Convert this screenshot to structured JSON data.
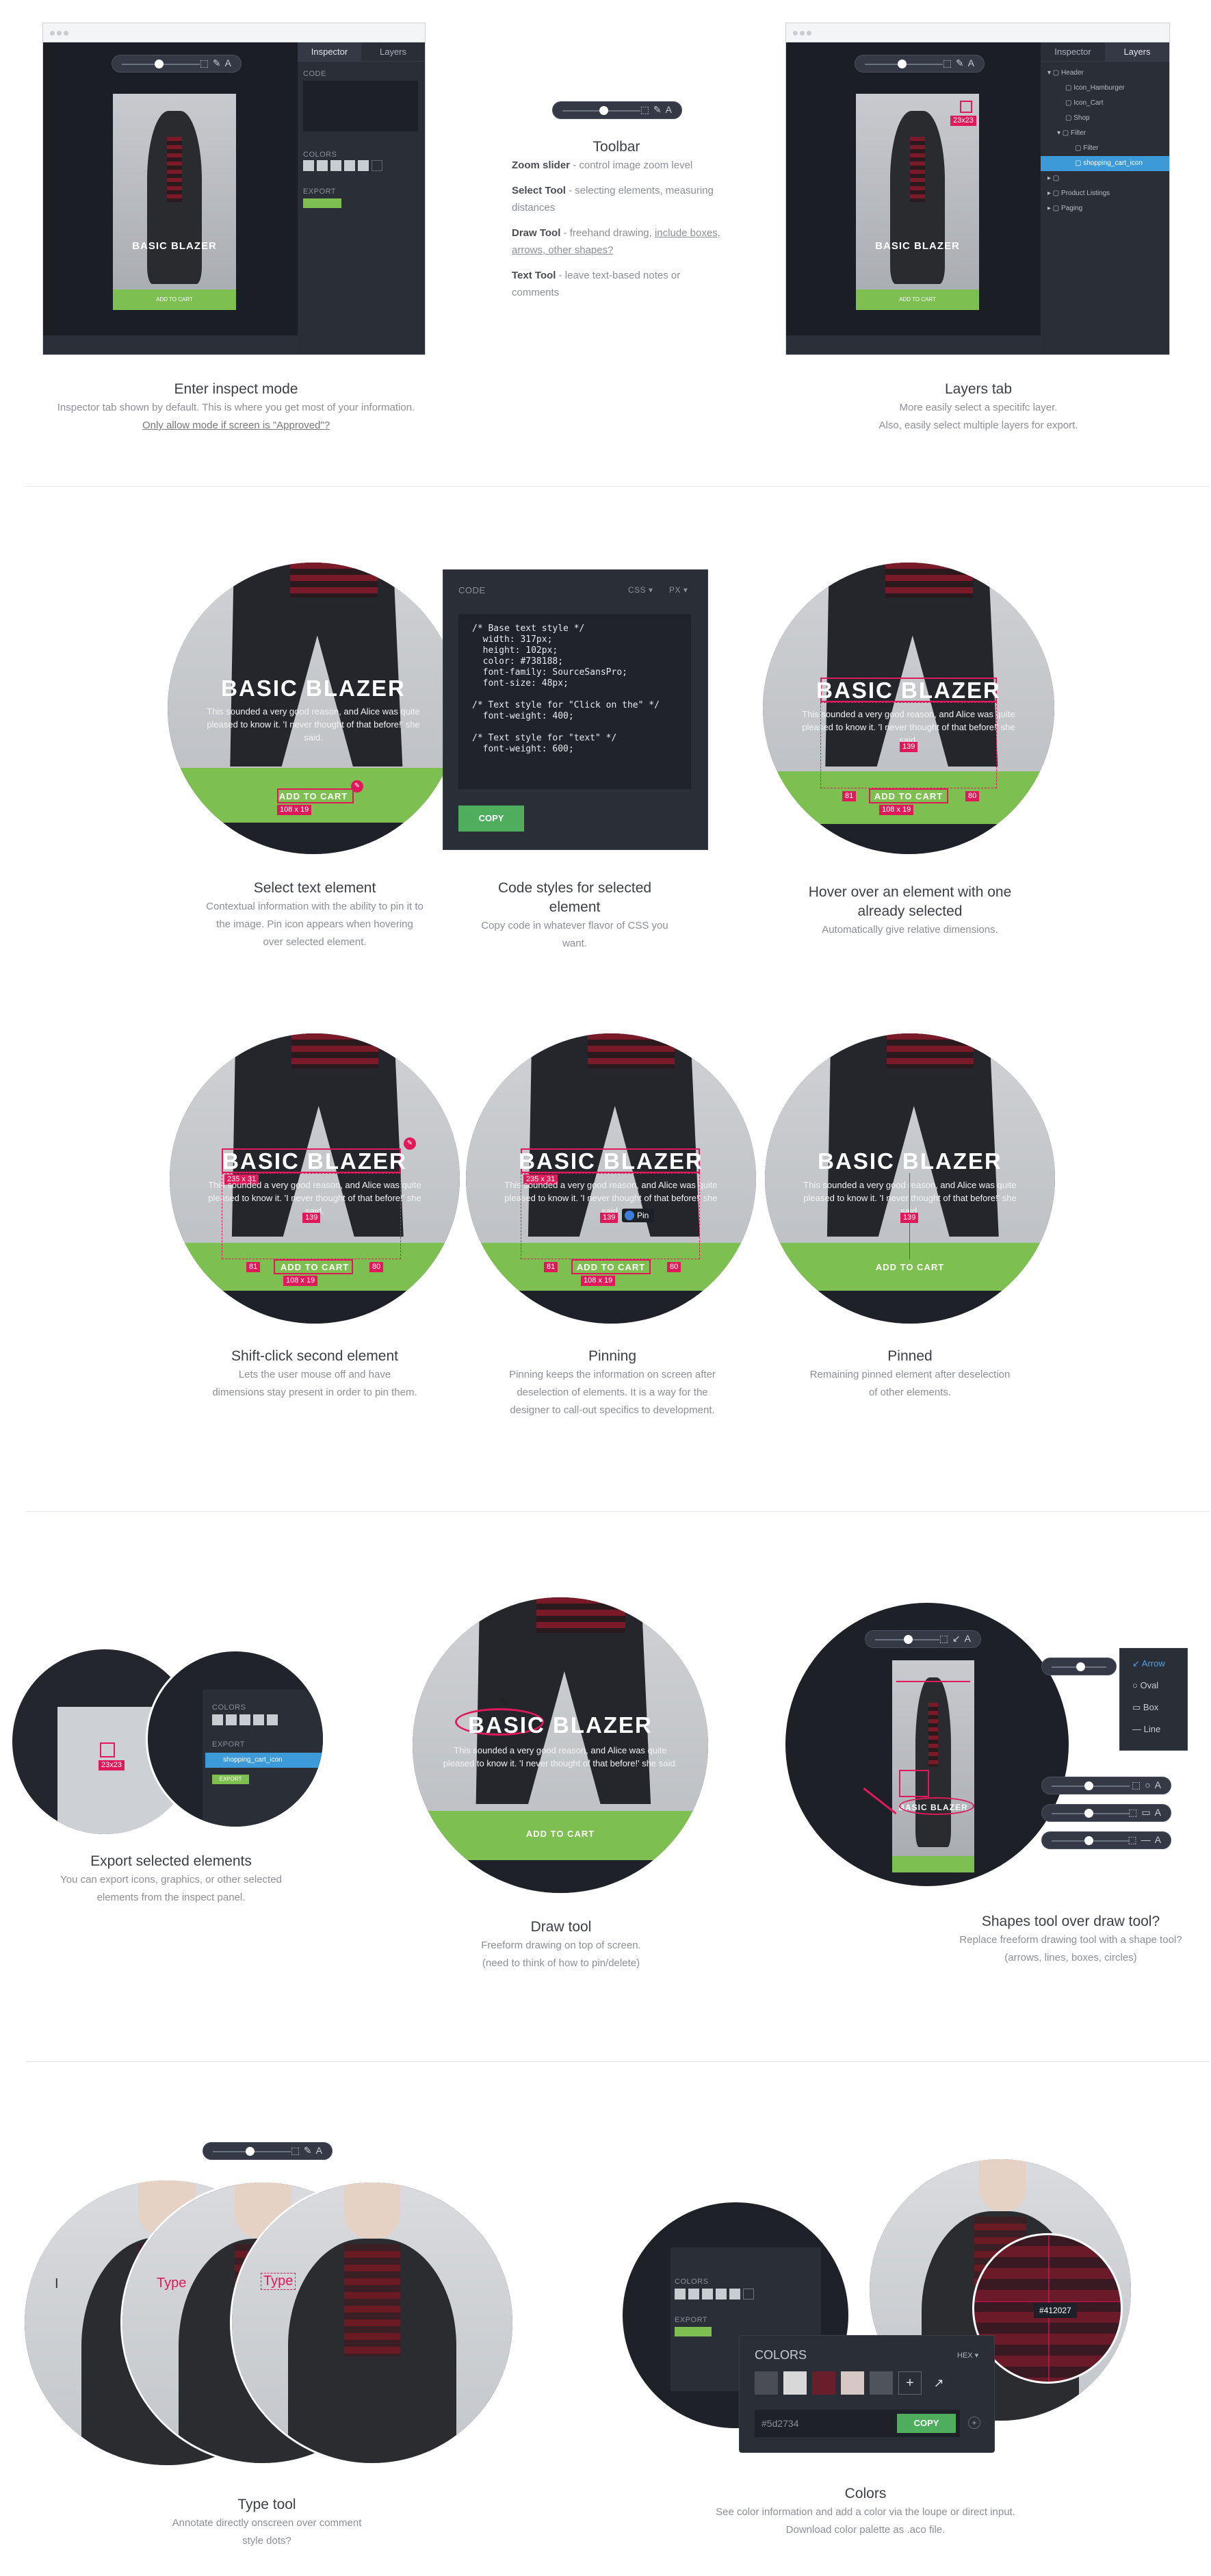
{
  "section1": {
    "inspect": {
      "window": {
        "tabs": [
          "Inspector",
          "Layers"
        ],
        "code_label": "CODE",
        "colors_label": "COLORS",
        "export_label": "EXPORT",
        "phone_title": "BASIC BLAZER",
        "phone_cta": "ADD TO CART"
      },
      "title": "Enter inspect mode",
      "desc": "Inspector tab shown by default. This is where you get most of your information.",
      "link": "Only allow mode if screen is \"Approved\"?"
    },
    "toolbar": {
      "title": "Toolbar",
      "items": [
        {
          "name": "Zoom slider",
          "text": " - control image zoom level"
        },
        {
          "name": "Select Tool",
          "text": " - selecting elements, measuring distances"
        },
        {
          "name": "Draw Tool",
          "text": " - freehand drawing, ",
          "link": "include boxes, arrows, other shapes?"
        },
        {
          "name": "Text Tool",
          "text": " - leave text-based notes or comments"
        }
      ]
    },
    "layers": {
      "window": {
        "tabs": [
          "Inspector",
          "Layers"
        ],
        "layer_items": [
          "Header",
          "Icon_Hamburger",
          "Icon_Cart",
          "Shop",
          "Filter",
          "Filter",
          "shopping_cart_icon",
          "",
          "Product Listings",
          "Paging"
        ],
        "size_tag": "23x23",
        "phone_title": "BASIC BLAZER",
        "phone_cta": "ADD TO CART"
      },
      "title": "Layers tab",
      "desc1": "More easily select a specitifc layer.",
      "desc2": "Also, easily select multiple layers for export."
    }
  },
  "section2": {
    "select_text": {
      "big_title": "BASIC BLAZER",
      "para": "This sounded a very good reason, and Alice was quite pleased to know it. 'I never thought of that before!' she said.",
      "cta": "ADD TO CART",
      "size": "108 x 19",
      "title": "Select text element",
      "desc": "Contextual information with the ability to pin it to the image. Pin icon appears when hovering over selected element."
    },
    "code_styles": {
      "header": "CODE",
      "lang": "CSS ▾",
      "unit": "PX ▾",
      "code": "/* Base text style */\n  width: 317px;\n  height: 102px;\n  color: #738188;\n  font-family: SourceSansPro;\n  font-size: 48px;\n\n/* Text style for \"Click on the\" */\n  font-weight: 400;\n\n/* Text style for \"text\" */\n  font-weight: 600;",
      "copy": "COPY",
      "title": "Code styles for selected element",
      "desc": "Copy code in whatever flavor of CSS you want."
    },
    "hover": {
      "big_title": "BASIC BLAZER",
      "para": "This sounded a very good reason, and Alice was quite pleased to know it. 'I never thought of that before!' she said.",
      "cta": "ADD TO CART",
      "dist_v": "139",
      "dist_l": "81",
      "dist_r": "80",
      "size": "108 x 19",
      "title": "Hover over an element with one already selected",
      "desc": "Automatically give relative dimensions."
    }
  },
  "section3": {
    "shift": {
      "big_title": "BASIC BLAZER",
      "para": "This sounded a very good reason, and Alice was quite pleased to know it. 'I never thought of that before!' she said.",
      "cta": "ADD TO CART",
      "size_top": "235 x 31",
      "dist_v": "139",
      "dist_l": "81",
      "dist_r": "80",
      "size": "108 x 19",
      "title": "Shift-click second element",
      "desc": "Lets the user mouse off and have dimensions stay present in order to pin them."
    },
    "pinning": {
      "big_title": "BASIC BLAZER",
      "para": "This sounded a very good reason, and Alice was quite pleased to know it. 'I never thought of that before!' she said.",
      "cta": "ADD TO CART",
      "size_top": "235 x 31",
      "dist_v": "139",
      "dist_l": "81",
      "dist_r": "80",
      "size": "108 x 19",
      "pin": "Pin",
      "title": "Pinning",
      "desc": "Pinning keeps the information on screen after deselection of elements. It is a way for the designer to call-out specifics to development."
    },
    "pinned": {
      "big_title": "BASIC BLAZER",
      "para": "This sounded a very good reason, and Alice was quite pleased to know it. 'I never thought of that before!' she said.",
      "cta": "ADD TO CART",
      "dist_v": "139",
      "title": "Pinned",
      "desc": "Remaining pinned element after deselection of other elements."
    }
  },
  "section4": {
    "export": {
      "tag": "23x23",
      "colors_label": "COLORS",
      "export_label": "EXPORT",
      "selected_layer": "shopping_cart_icon",
      "export_btn": "EXPORT",
      "title": "Export selected elements",
      "desc": "You can export icons, graphics, or other selected elements from the inspect panel."
    },
    "draw": {
      "big_title": "BASIC BLAZER",
      "para": "This sounded a very good reason, and Alice was quite pleased to know it. 'I never thought of that before!' she said.",
      "cta": "ADD TO CART",
      "title": "Draw tool",
      "desc1": "Freeform drawing on top of screen.",
      "desc2": "(need to think of how to pin/delete)"
    },
    "shapes": {
      "menu": [
        "Arrow",
        "Oval",
        "Box",
        "Line"
      ],
      "phone_title": "BASIC BLAZER",
      "title": "Shapes tool over draw tool?",
      "desc": "Replace freeform drawing tool with a shape tool? (arrows, lines, boxes, circles)"
    }
  },
  "section5": {
    "type": {
      "sample1": "Type",
      "sample2": "Type",
      "title": "Type tool",
      "desc": "Annotate directly onscreen over comment style dots?"
    },
    "colors": {
      "colors_label": "COLORS",
      "export_label": "EXPORT",
      "panel_title": "COLORS",
      "format": "HEX ▾",
      "hex_value": "#5d2734",
      "copy": "COPY",
      "loupe_value": "#412027",
      "swatches": [
        "#4a4d54",
        "#d8d8d8",
        "#6a1e2c",
        "#d8c8c4",
        "#4e535c"
      ],
      "title": "Colors",
      "desc": "See color information and add a color via the loupe or direct input. Download color palette as .aco file."
    }
  }
}
